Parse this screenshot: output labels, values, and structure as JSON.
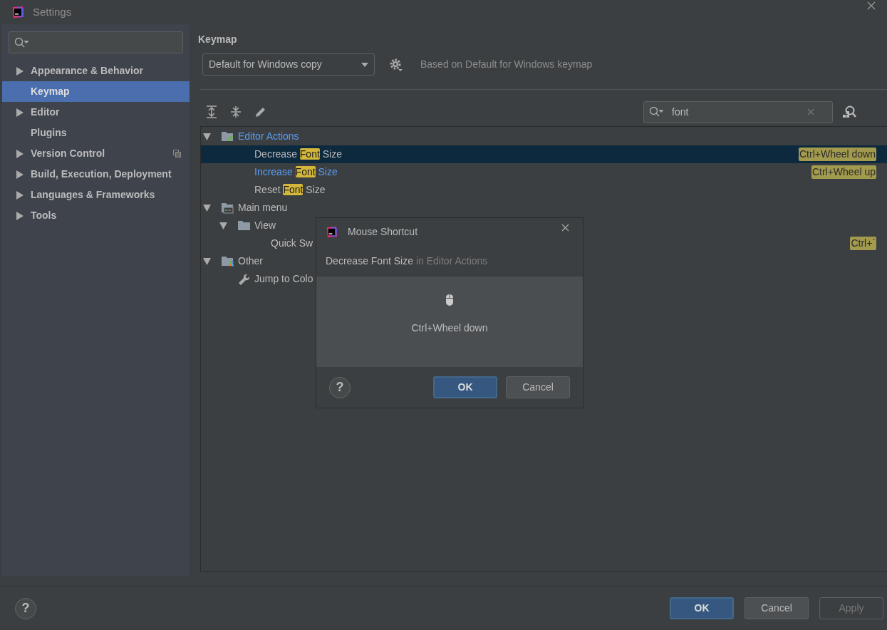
{
  "window": {
    "title": "Settings"
  },
  "sidebar": {
    "items": [
      {
        "label": "Appearance & Behavior",
        "expandable": true,
        "selected": false,
        "project_level": false
      },
      {
        "label": "Keymap",
        "expandable": false,
        "selected": true,
        "project_level": false
      },
      {
        "label": "Editor",
        "expandable": true,
        "selected": false,
        "project_level": false
      },
      {
        "label": "Plugins",
        "expandable": false,
        "selected": false,
        "project_level": false
      },
      {
        "label": "Version Control",
        "expandable": true,
        "selected": false,
        "project_level": true
      },
      {
        "label": "Build, Execution, Deployment",
        "expandable": true,
        "selected": false,
        "project_level": false
      },
      {
        "label": "Languages & Frameworks",
        "expandable": true,
        "selected": false,
        "project_level": false
      },
      {
        "label": "Tools",
        "expandable": true,
        "selected": false,
        "project_level": false
      }
    ]
  },
  "keymap": {
    "title": "Keymap",
    "scheme": "Default for Windows copy",
    "based_on": "Based on Default for Windows keymap",
    "search_value": "font",
    "tree": [
      {
        "parts": [
          "Editor Actions"
        ],
        "kind": "editor-group",
        "modified": true,
        "selected": false,
        "expanded": true,
        "children": [
          {
            "parts": [
              "Decrease ",
              "Font",
              " Size"
            ],
            "modified": false,
            "selected": true,
            "shortcut": "Ctrl+Wheel down"
          },
          {
            "parts": [
              "Increase ",
              "Font",
              " Size"
            ],
            "modified": true,
            "selected": false,
            "shortcut": "Ctrl+Wheel up"
          },
          {
            "parts": [
              "Reset ",
              "Font",
              " Size"
            ],
            "modified": false,
            "selected": false
          }
        ]
      },
      {
        "parts": [
          "Main menu"
        ],
        "kind": "menu-group",
        "modified": false,
        "selected": false,
        "expanded": true,
        "children": [
          {
            "parts": [
              "View"
            ],
            "kind": "folder",
            "modified": false,
            "selected": false,
            "expanded": true,
            "children": [
              {
                "parts": [
                  "Quick Sw"
                ],
                "modified": false,
                "selected": false,
                "shortcut": "Ctrl+`"
              }
            ]
          }
        ]
      },
      {
        "parts": [
          "Other"
        ],
        "kind": "other-group",
        "modified": false,
        "selected": false,
        "expanded": true,
        "children": [
          {
            "parts": [
              "Jump to Colo"
            ],
            "kind": "tool",
            "modified": false,
            "selected": false
          }
        ]
      }
    ]
  },
  "dialog": {
    "title": "Mouse Shortcut",
    "help": "?",
    "action": "Decrease Font Size",
    "context": "in Editor Actions",
    "shortcut": "Ctrl+Wheel down",
    "buttons": [
      {
        "label": "OK",
        "default": true
      },
      {
        "label": "Cancel",
        "default": false
      }
    ]
  },
  "help": "?",
  "buttons": [
    {
      "label": "OK",
      "default": true,
      "disabled": false
    },
    {
      "label": "Cancel",
      "default": false,
      "disabled": false
    },
    {
      "label": "Apply",
      "default": false,
      "disabled": true
    }
  ]
}
